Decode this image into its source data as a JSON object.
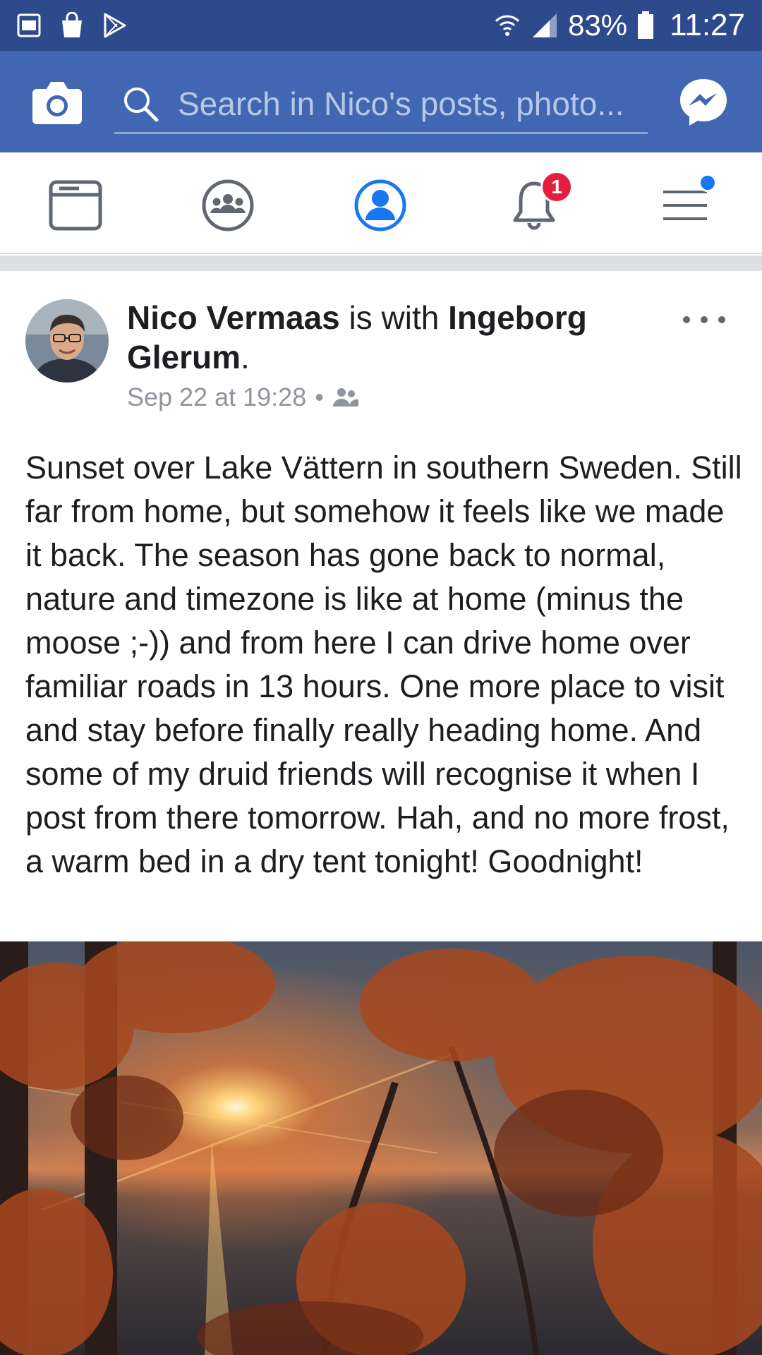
{
  "status_bar": {
    "battery": "83%",
    "time": "11:27",
    "icons": [
      "gallery-icon",
      "shopping-bag-icon",
      "play-store-icon",
      "wifi-icon",
      "signal-icon",
      "battery-icon"
    ]
  },
  "header": {
    "search_placeholder": "Search in Nico's posts, photo...",
    "icons": [
      "camera-icon",
      "search-icon",
      "messenger-icon"
    ],
    "brand_color": "#4267b2"
  },
  "nav": {
    "items": [
      {
        "name": "news-feed",
        "icon": "news-feed-icon"
      },
      {
        "name": "groups",
        "icon": "groups-icon"
      },
      {
        "name": "profile",
        "icon": "profile-icon",
        "active": true
      },
      {
        "name": "notifications",
        "icon": "bell-icon",
        "badge": "1"
      },
      {
        "name": "menu",
        "icon": "menu-icon",
        "dot": true
      }
    ],
    "active_color": "#1877f2"
  },
  "post": {
    "author": "Nico Vermaas",
    "with_text": "is with",
    "tagged": "Ingeborg Glerum",
    "period": ".",
    "timestamp": "Sep 22 at 19:28",
    "separator": "•",
    "audience_icon": "friends-icon",
    "text": "Sunset over Lake Vättern in southern Sweden. Still far from home, but somehow it feels like we made it back. The season has gone back to normal, nature and timezone is like at home (minus the moose ;-)) and from here I can drive home over familiar roads in 13 hours. One more place to visit and stay before finally really heading home. And some of my druid friends will recognise it when I post from there tomorrow. Hah, and no more frost, a warm bed in a dry tent tonight! Goodnight!"
  }
}
